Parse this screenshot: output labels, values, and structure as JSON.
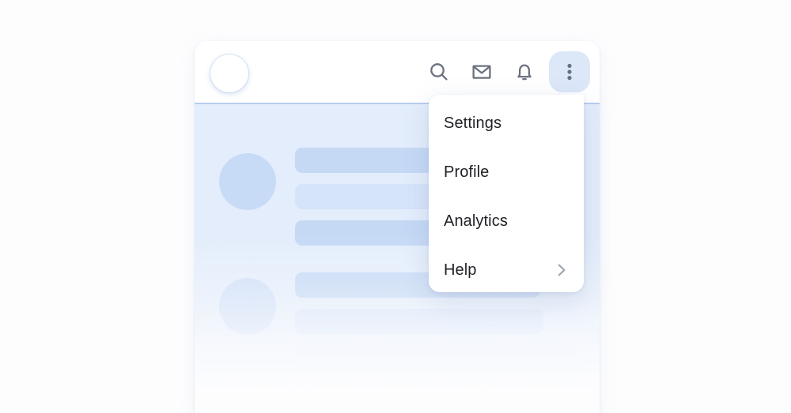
{
  "colors": {
    "page_background": "#fdfdfe",
    "card_background": "#ffffff",
    "content_background": "#e3edfb",
    "skeleton_strong": "#c5d9f5",
    "skeleton_circle": "#c8dbf6",
    "divider": "#b8cdf0",
    "active_button_background": "#dce7f8",
    "icon_gray": "#6b7280",
    "menu_text": "#1f2024",
    "chevron_gray": "#9ca3af"
  },
  "app_card": {
    "header": {
      "avatar": {
        "name": "user-avatar",
        "shape": "circle"
      },
      "actions": [
        {
          "name": "search-icon",
          "label": "Search"
        },
        {
          "name": "mail-icon",
          "label": "Mail"
        },
        {
          "name": "bell-icon",
          "label": "Notifications"
        },
        {
          "name": "more-vertical-icon",
          "label": "More options"
        }
      ]
    },
    "content": {
      "type": "skeleton-placeholder",
      "rows": [
        {
          "avatar": true,
          "bars": 3
        },
        {
          "avatar": true,
          "bars": 3
        }
      ]
    }
  },
  "dropdown_menu": {
    "items": [
      {
        "label": "Settings",
        "has_submenu": false
      },
      {
        "label": "Profile",
        "has_submenu": false
      },
      {
        "label": "Analytics",
        "has_submenu": false
      },
      {
        "label": "Help",
        "has_submenu": true,
        "submenu_icon": "chevron-right-icon"
      }
    ]
  }
}
